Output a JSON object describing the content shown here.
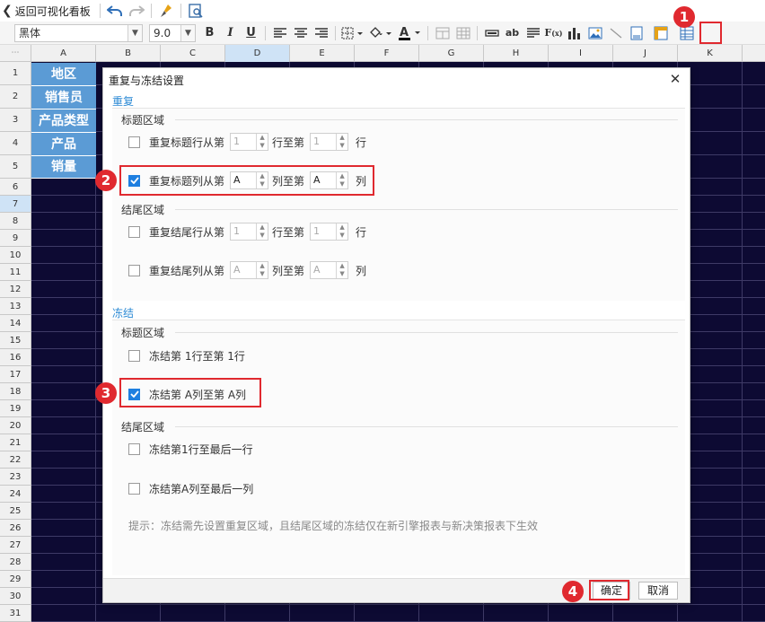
{
  "topbar": {
    "back_label": "返回可视化看板"
  },
  "format_toolbar": {
    "font_family": "黑体",
    "font_size": "9.0"
  },
  "grid": {
    "columns": [
      "A",
      "B",
      "C",
      "D",
      "E",
      "F",
      "G",
      "H",
      "I",
      "J",
      "K"
    ],
    "selected_column": "D",
    "rows": [
      "1",
      "2",
      "3",
      "4",
      "5",
      "6",
      "7",
      "8",
      "9",
      "10",
      "11",
      "12",
      "13",
      "14",
      "15",
      "16",
      "17",
      "18",
      "19",
      "20",
      "21",
      "22",
      "23",
      "24",
      "25",
      "26",
      "27",
      "28",
      "29",
      "30",
      "31"
    ],
    "selected_row": "7",
    "header_cells": [
      "地区",
      "销售员",
      "产品类型",
      "产品",
      "销量"
    ]
  },
  "dialog": {
    "title": "重复与冻结设置",
    "repeat": {
      "title": "重复",
      "header_area": {
        "title": "标题区域",
        "row_option": {
          "label_from": "重复标题行从第",
          "from_value": "1",
          "label_to": "行至第",
          "to_value": "1",
          "suffix": "行",
          "checked": false
        },
        "col_option": {
          "label_from": "重复标题列从第",
          "from_value": "A",
          "label_to": "列至第",
          "to_value": "A",
          "suffix": "列",
          "checked": true
        }
      },
      "footer_area": {
        "title": "结尾区域",
        "row_option": {
          "label_from": "重复结尾行从第",
          "from_value": "1",
          "label_to": "行至第",
          "to_value": "1",
          "suffix": "行",
          "checked": false
        },
        "col_option": {
          "label_from": "重复结尾列从第",
          "from_value": "A",
          "label_to": "列至第",
          "to_value": "A",
          "suffix": "列",
          "checked": false
        }
      }
    },
    "freeze": {
      "title": "冻结",
      "header_area": {
        "title": "标题区域",
        "row_option": {
          "label": "冻结第 1行至第 1行",
          "checked": false
        },
        "col_option": {
          "label": "冻结第 A列至第 A列",
          "checked": true
        }
      },
      "footer_area": {
        "title": "结尾区域",
        "row_option": {
          "label": "冻结第1行至最后一行",
          "checked": false
        },
        "col_option": {
          "label": "冻结第A列至最后一列",
          "checked": false
        }
      }
    },
    "hint": "提示：冻结需先设置重复区域，且结尾区域的冻结仅在新引擎报表与新决策报表下生效",
    "ok_label": "确定",
    "cancel_label": "取消"
  },
  "annotations": [
    "1",
    "2",
    "3",
    "4"
  ],
  "colors": {
    "accent": "#2e8bd5",
    "highlight": "#e0292f",
    "grid_bg": "#0d0a33",
    "header_cell": "#5b9bd5",
    "checkbox_on": "#1e7fe0"
  }
}
